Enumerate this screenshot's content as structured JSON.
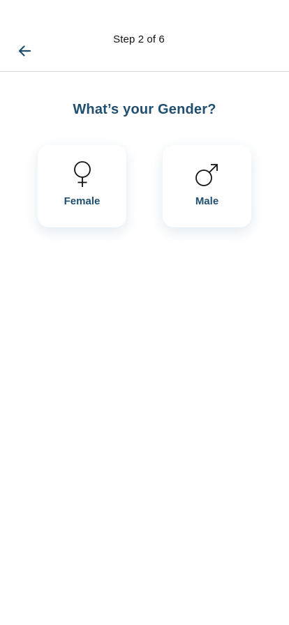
{
  "header": {
    "step_label": "Step 2 of 6",
    "back_icon": "arrow-left-icon"
  },
  "question": {
    "title": "What’s your Gender?"
  },
  "options": [
    {
      "label": "Female",
      "icon": "female-symbol-icon",
      "selected": false
    },
    {
      "label": "Male",
      "icon": "male-symbol-icon",
      "selected": false
    }
  ],
  "colors": {
    "primary": "#1f4e6e",
    "text": "#111111",
    "divider": "#d9d9d9",
    "background": "#ffffff"
  }
}
